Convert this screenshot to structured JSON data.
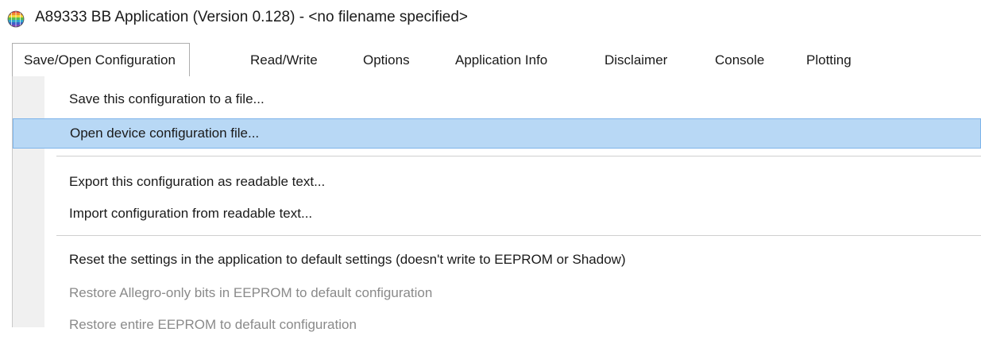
{
  "window": {
    "title": "A89333 BB Application (Version 0.128)  -  <no filename specified>",
    "icon": "rainbow-globe-icon"
  },
  "tabs": [
    {
      "label": "Save/Open Configuration",
      "active": true
    },
    {
      "label": "Read/Write",
      "active": false
    },
    {
      "label": "Options",
      "active": false
    },
    {
      "label": "Application Info",
      "active": false
    },
    {
      "label": "Disclaimer",
      "active": false
    },
    {
      "label": "Console",
      "active": false
    },
    {
      "label": "Plotting",
      "active": false
    }
  ],
  "menu": {
    "items": [
      {
        "label": "Save this configuration to a file...",
        "enabled": true,
        "highlighted": false
      },
      {
        "label": "Open device configuration file...",
        "enabled": true,
        "highlighted": true
      },
      {
        "label": "Export this configuration as readable text...",
        "enabled": true,
        "highlighted": false
      },
      {
        "label": "Import configuration from readable text...",
        "enabled": true,
        "highlighted": false
      },
      {
        "label": "Reset the settings in the application to default settings (doesn't write to EEPROM or Shadow)",
        "enabled": true,
        "highlighted": false
      },
      {
        "label": "Restore Allegro-only bits in EEPROM to default configuration",
        "enabled": false,
        "highlighted": false
      },
      {
        "label": "Restore entire EEPROM to default configuration",
        "enabled": false,
        "highlighted": false
      }
    ]
  },
  "colors": {
    "highlight": "#b8d8f5",
    "highlight_border": "#7eb4ea",
    "disabled_text": "#8a8a8a",
    "gutter": "#f0f0f0"
  }
}
